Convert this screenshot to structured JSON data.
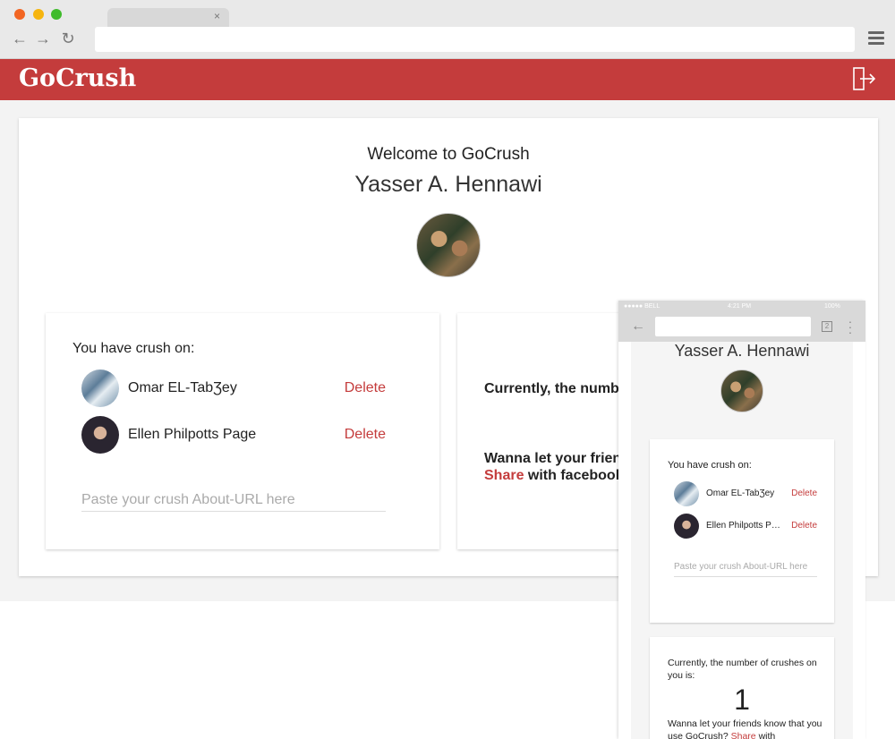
{
  "browser": {
    "tab_close": "×"
  },
  "app": {
    "logo": "GoCrush"
  },
  "main": {
    "welcome": "Welcome to GoCrush",
    "user_name": "Yasser A. Hennawi"
  },
  "crush_card": {
    "title": "You have crush on:",
    "crushes": [
      {
        "name": "Omar EL-TabƷey",
        "delete_label": "Delete"
      },
      {
        "name": "Ellen Philpotts Page",
        "delete_label": "Delete"
      }
    ],
    "input_placeholder": "Paste your crush About-URL here"
  },
  "count_card": {
    "count_text": "Currently, the number",
    "share_line1": "Wanna let your friend",
    "share_link": "Share",
    "share_rest": " with facebook"
  },
  "phone": {
    "status_carrier": "●●●●● BELL",
    "status_time": "4:21 PM",
    "status_battery": "100%",
    "tabs_count": "2",
    "user_name": "Yasser A. Hennawi",
    "crush_title": "You have crush on:",
    "crushes": [
      {
        "name": "Omar EL-TabƷey",
        "delete_label": "Delete"
      },
      {
        "name": "Ellen Philpotts Page",
        "delete_label": "Delete"
      }
    ],
    "input_placeholder": "Paste your crush About-URL here",
    "count_text": "Currently, the number of crushes on you is:",
    "count_value": "1",
    "share_text": "Wanna let your friends know that you use GoCrush?",
    "share_link": "Share",
    "share_rest": " with"
  },
  "colors": {
    "brand": "#c43c3c",
    "traffic_red": "#f26522",
    "traffic_yellow": "#f6b50e",
    "traffic_green": "#3fbb2b"
  }
}
